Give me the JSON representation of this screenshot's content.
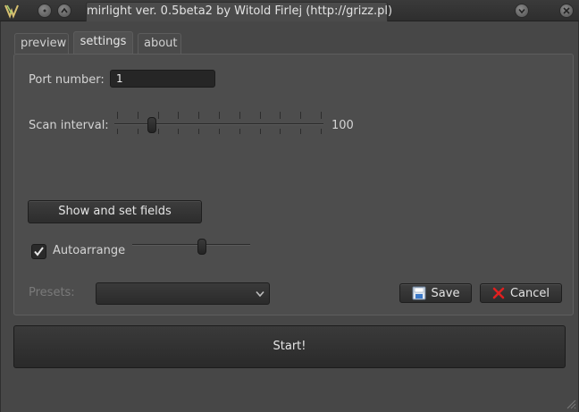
{
  "window": {
    "title": "mirlight ver. 0.5beta2 by Witold Firlej (http://grizz.pl)"
  },
  "tabs": [
    {
      "label": "preview",
      "active": false
    },
    {
      "label": "settings",
      "active": true
    },
    {
      "label": "about",
      "active": false
    }
  ],
  "settings": {
    "port_label": "Port number:",
    "port_value": "1",
    "scan_label": "Scan interval:",
    "scan_value": "100",
    "scan_slider_fraction": 0.15,
    "show_fields_label": "Show and set fields",
    "autoarrange_label": "Autoarrange",
    "autoarrange_checked": true,
    "autoarrange_slider_fraction": 0.55,
    "presets_label": "Presets:",
    "presets_selected": "",
    "save_label": "Save",
    "cancel_label": "Cancel"
  },
  "start_label": "Start!",
  "colors": {
    "background": "#474747",
    "cancel_icon": "#e02020",
    "save_icon": "#3a78c8"
  }
}
